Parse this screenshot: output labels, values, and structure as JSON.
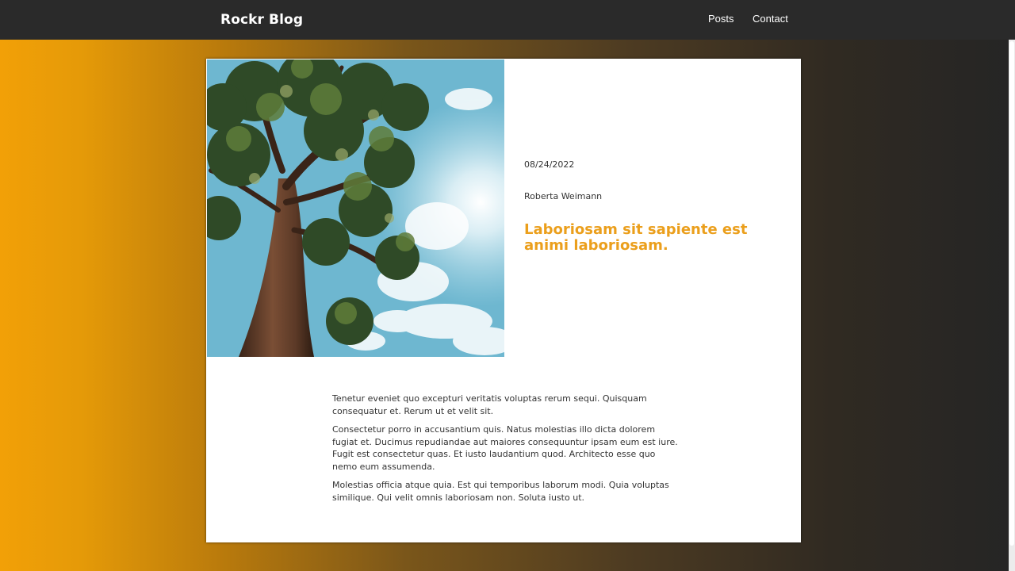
{
  "navbar": {
    "brand": "Rockr Blog",
    "links": [
      {
        "label": "Posts"
      },
      {
        "label": "Contact"
      }
    ]
  },
  "colors": {
    "background_gradient_start": "#f2a007",
    "background_gradient_end": "#252525",
    "navbar": "#2a2a2a",
    "title_accent": "#eb9f1c",
    "card": "#ffffff"
  },
  "post": {
    "image_alt": "tree-photo",
    "date": "08/24/2022",
    "author": "Roberta Weimann",
    "title": "Laboriosam sit sapiente est animi laboriosam.",
    "paragraphs": [
      "Tenetur eveniet quo excepturi veritatis voluptas rerum sequi. Quisquam consequatur et. Rerum ut et velit sit.",
      "Consectetur porro in accusantium quis. Natus molestias illo dicta dolorem fugiat et. Ducimus repudiandae aut maiores consequuntur ipsam eum est iure. Fugit est consectetur quas. Et iusto laudantium quod. Architecto esse quo nemo eum assumenda.",
      "Molestias officia atque quia. Est qui temporibus laborum modi. Quia voluptas similique. Qui velit omnis laboriosam non. Soluta iusto ut."
    ]
  }
}
